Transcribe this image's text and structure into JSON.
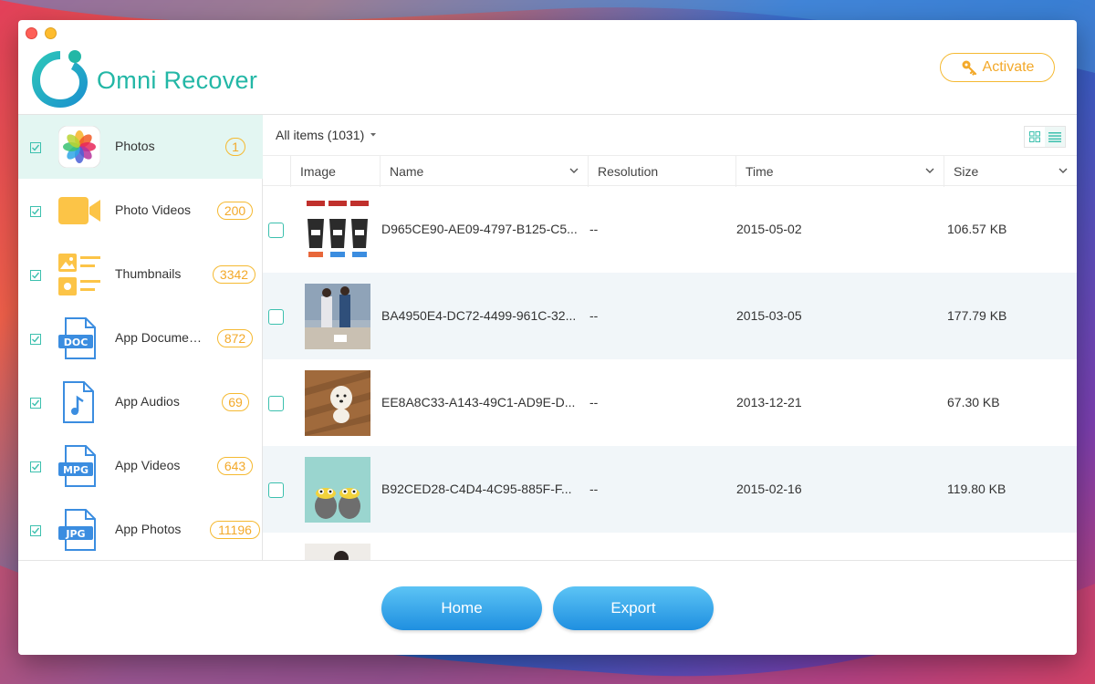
{
  "app": {
    "name": "Omni Recover"
  },
  "header": {
    "activate_label": "Activate"
  },
  "colors": {
    "accent": "#23b7a6",
    "badge": "#f5b931",
    "button": "#2a9ae6"
  },
  "sidebar": {
    "items": [
      {
        "label": "Photos",
        "count": "1",
        "icon": "photos-icon",
        "checked": true,
        "active": true
      },
      {
        "label": "Photo Videos",
        "count": "200",
        "icon": "video-camera-icon",
        "checked": true
      },
      {
        "label": "Thumbnails",
        "count": "3342",
        "icon": "thumbnails-icon",
        "checked": true
      },
      {
        "label": "App Documents",
        "count": "872",
        "icon": "doc-file-icon",
        "checked": true
      },
      {
        "label": "App Audios",
        "count": "69",
        "icon": "audio-file-icon",
        "checked": true
      },
      {
        "label": "App Videos",
        "count": "643",
        "icon": "mpg-file-icon",
        "checked": true
      },
      {
        "label": "App Photos",
        "count": "11196",
        "icon": "jpg-file-icon",
        "checked": true
      }
    ]
  },
  "main": {
    "filter_label": "All items (1031)",
    "columns": {
      "image": "Image",
      "name": "Name",
      "resolution": "Resolution",
      "time": "Time",
      "size": "Size"
    },
    "rows": [
      {
        "name": "D965CE90-AE09-4797-B125-C5...",
        "resolution": "--",
        "time": "2015-05-02",
        "size": "106.57 KB"
      },
      {
        "name": "BA4950E4-DC72-4499-961C-32...",
        "resolution": "--",
        "time": "2015-03-05",
        "size": "177.79 KB"
      },
      {
        "name": "EE8A8C33-A143-49C1-AD9E-D...",
        "resolution": "--",
        "time": "2013-12-21",
        "size": "67.30 KB"
      },
      {
        "name": "B92CED28-C4D4-4C95-885F-F...",
        "resolution": "--",
        "time": "2015-02-16",
        "size": "119.80 KB"
      }
    ]
  },
  "footer": {
    "home_label": "Home",
    "export_label": "Export"
  }
}
